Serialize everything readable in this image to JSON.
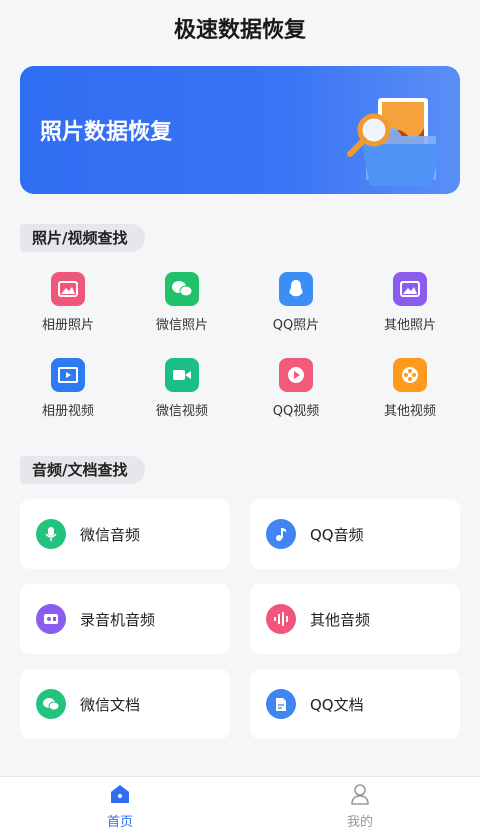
{
  "app": {
    "title": "极速数据恢复"
  },
  "banner": {
    "label": "照片数据恢复"
  },
  "sections": {
    "media": {
      "label": "照片/视频查找"
    },
    "audio_docs": {
      "label": "音频/文档查找"
    }
  },
  "media_items": [
    {
      "label": "相册照片",
      "icon": "album-photo-icon",
      "color": "#f0557a"
    },
    {
      "label": "微信照片",
      "icon": "wechat-photo-icon",
      "color": "#20c36a"
    },
    {
      "label": "QQ照片",
      "icon": "qq-photo-icon",
      "color": "#3a8ef6"
    },
    {
      "label": "其他照片",
      "icon": "other-photo-icon",
      "color": "#8a5cf0"
    },
    {
      "label": "相册视频",
      "icon": "album-video-icon",
      "color": "#2d7bf0"
    },
    {
      "label": "微信视频",
      "icon": "wechat-video-icon",
      "color": "#1bbf86"
    },
    {
      "label": "QQ视频",
      "icon": "qq-video-icon",
      "color": "#f25a7c"
    },
    {
      "label": "其他视频",
      "icon": "other-video-icon",
      "color": "#ff9a1f"
    }
  ],
  "audio_doc_items": [
    {
      "label": "微信音频",
      "icon": "microphone-icon",
      "color": "#23c37e"
    },
    {
      "label": "QQ音频",
      "icon": "music-note-icon",
      "color": "#3f86f2"
    },
    {
      "label": "录音机音频",
      "icon": "recorder-icon",
      "color": "#8a5cf0"
    },
    {
      "label": "其他音频",
      "icon": "sound-wave-icon",
      "color": "#f2557c"
    },
    {
      "label": "微信文档",
      "icon": "wechat-doc-icon",
      "color": "#23c37e"
    },
    {
      "label": "QQ文档",
      "icon": "document-icon",
      "color": "#3f86f2"
    }
  ],
  "tabbar": {
    "home": {
      "label": "首页",
      "color": "#2f6df2"
    },
    "mine": {
      "label": "我的",
      "color": "#999999"
    }
  }
}
